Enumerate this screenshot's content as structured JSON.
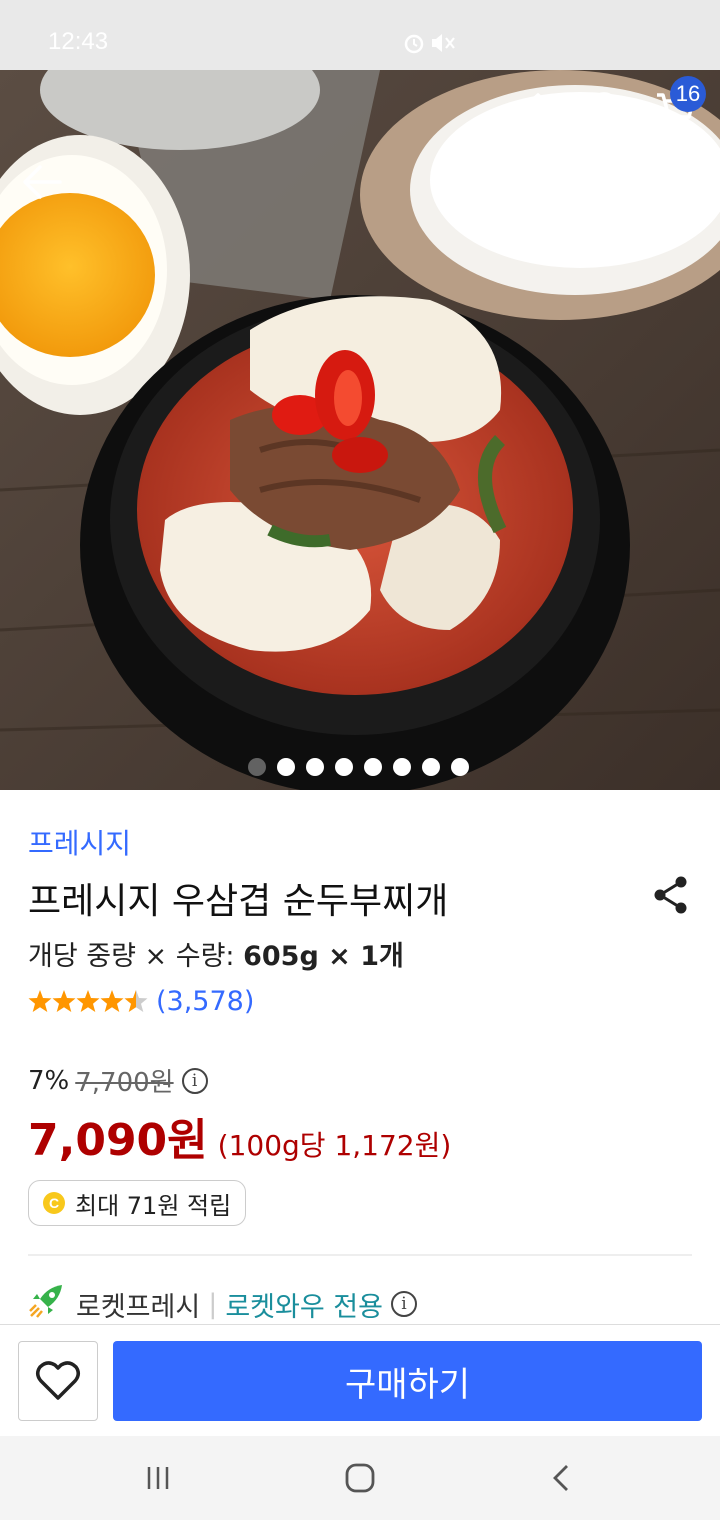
{
  "status_bar": {
    "time": "12:43"
  },
  "header": {
    "cart_count": "16"
  },
  "carousel": {
    "total": 8,
    "active_index": 0
  },
  "product": {
    "brand": "프레시지",
    "title": "프레시지 우삼겹 순두부찌개",
    "weight_label": "개당 중량 × 수량: ",
    "weight_value": "605g × 1개",
    "rating": 4.5,
    "review_count": "(3,578)",
    "discount_percent": "7%",
    "original_price": "7,700원",
    "sale_price": "7,090원",
    "unit_price": "(100g당 1,172원)",
    "cashback": "최대 71원 적립",
    "coin_symbol": "C",
    "delivery_type": "로켓프레시",
    "delivery_separator": "|",
    "membership": "로켓와우 전용"
  },
  "bottom_bar": {
    "buy_label": "구매하기"
  },
  "colors": {
    "accent": "#346aff",
    "price_red": "#ae0000",
    "wow_teal": "#1a8e9c",
    "star": "#ff9600"
  }
}
